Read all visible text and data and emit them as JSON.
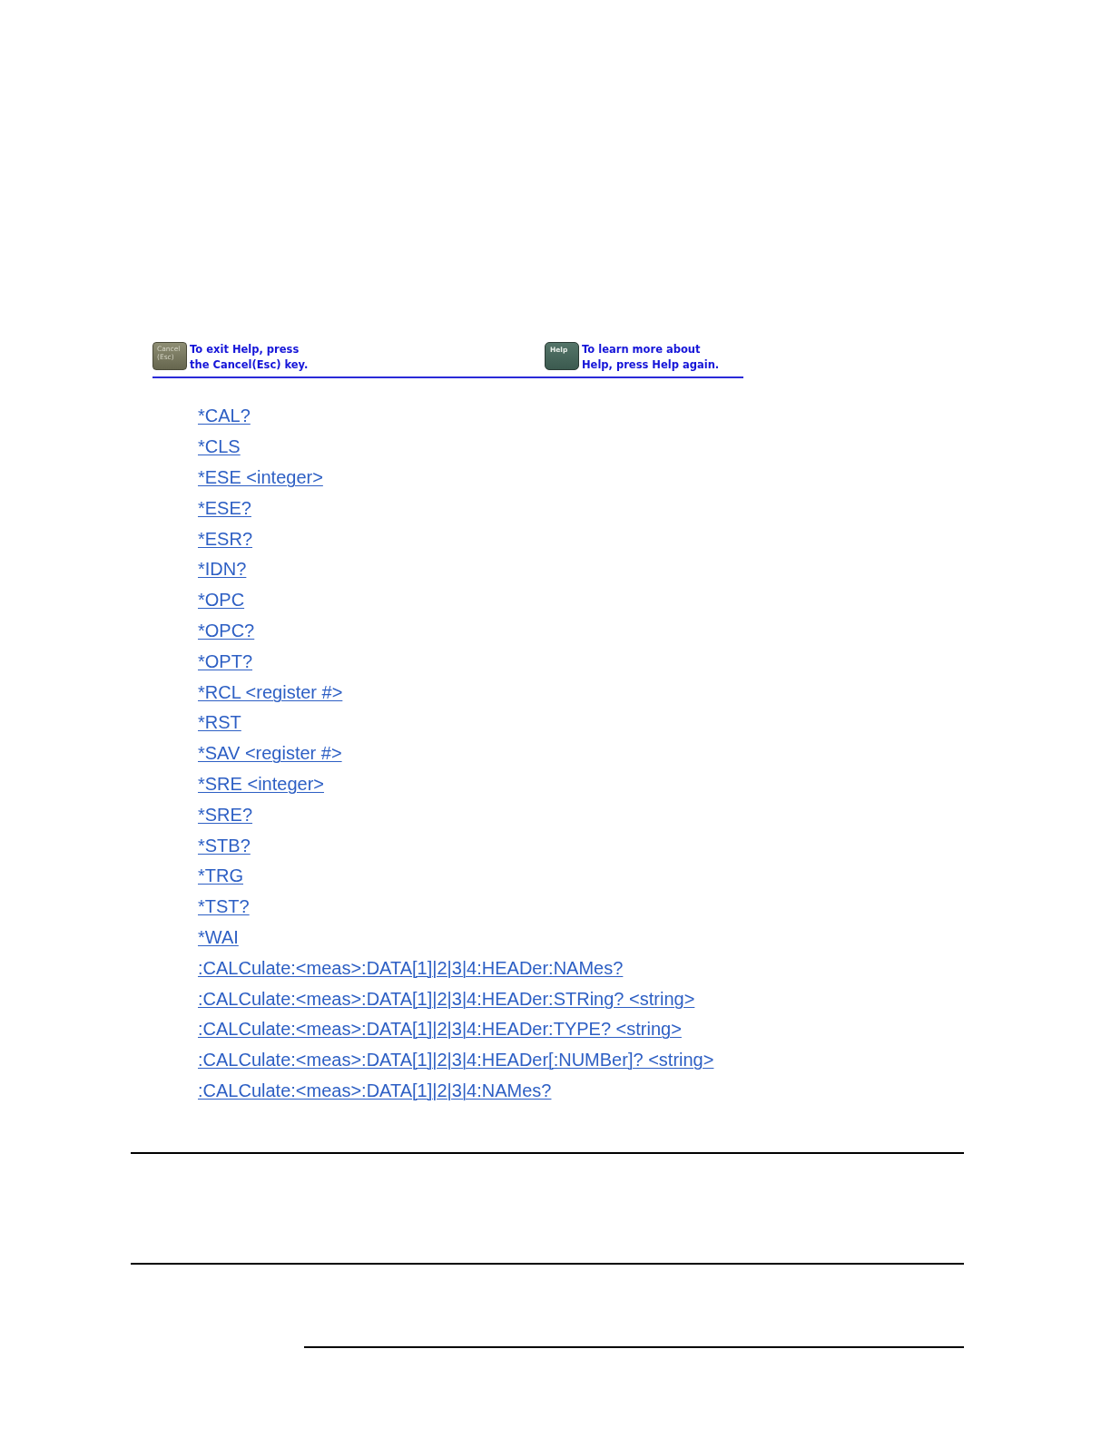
{
  "help_bar": {
    "exit": {
      "key_label": [
        "Cancel",
        "(Esc)"
      ],
      "hint": [
        "To exit Help, press",
        "the Cancel(Esc) key."
      ]
    },
    "more": {
      "key_label": [
        "Help"
      ],
      "hint": [
        "To learn more about",
        "Help, press Help again."
      ]
    }
  },
  "commands": [
    "*CAL?",
    "*CLS",
    "*ESE <integer>",
    "*ESE?",
    "*ESR?",
    "*IDN?",
    "*OPC",
    "*OPC?",
    "*OPT?",
    "*RCL <register #>",
    "*RST",
    "*SAV <register #>",
    "*SRE <integer>",
    "*SRE?",
    "*STB?",
    "*TRG",
    "*TST?",
    "*WAI",
    ":CALCulate:<meas>:DATA[1]|2|3|4:HEADer:NAMes?",
    ":CALCulate:<meas>:DATA[1]|2|3|4:HEADer:STRing? <string>",
    ":CALCulate:<meas>:DATA[1]|2|3|4:HEADer:TYPE? <string>",
    ":CALCulate:<meas>:DATA[1]|2|3|4:HEADer[:NUMBer]? <string>",
    ":CALCulate:<meas>:DATA[1]|2|3|4:NAMes?"
  ]
}
